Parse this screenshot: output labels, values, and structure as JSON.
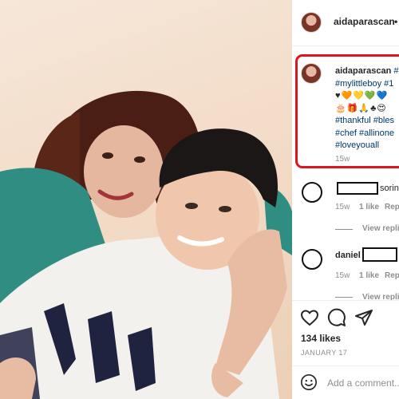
{
  "post": {
    "username": "aidaparascan",
    "header_more": "•"
  },
  "caption": {
    "username": "aidaparascan",
    "line1_tag": "#",
    "line2": "#mylittleboy #1",
    "line3_emoji": "♥🧡💛💚💙",
    "line4_emoji": "🎂🎁🙏♣😍",
    "line5": "#thankful #bles",
    "line6": "#chef #allinone",
    "line7": "#loveyouall",
    "time": "15w"
  },
  "comments": [
    {
      "visible_text": "sorin",
      "time": "15w",
      "likes": "1 like",
      "reply": "Reply",
      "view_replies": "View repli"
    },
    {
      "name": "daniel",
      "time": "15w",
      "likes": "1 like",
      "reply": "Reply",
      "view_replies": "View repli"
    }
  ],
  "likes_count": "134 likes",
  "date": "JANUARY 17",
  "add_comment": {
    "placeholder": "Add a comment..."
  },
  "icons": {
    "like": "heart-icon",
    "comment": "comment-icon",
    "share": "share-icon",
    "emoji": "emoji-icon"
  },
  "colors": {
    "highlight_box": "#e0141e",
    "hashtag": "#00376b",
    "muted": "#8e8e8e"
  }
}
